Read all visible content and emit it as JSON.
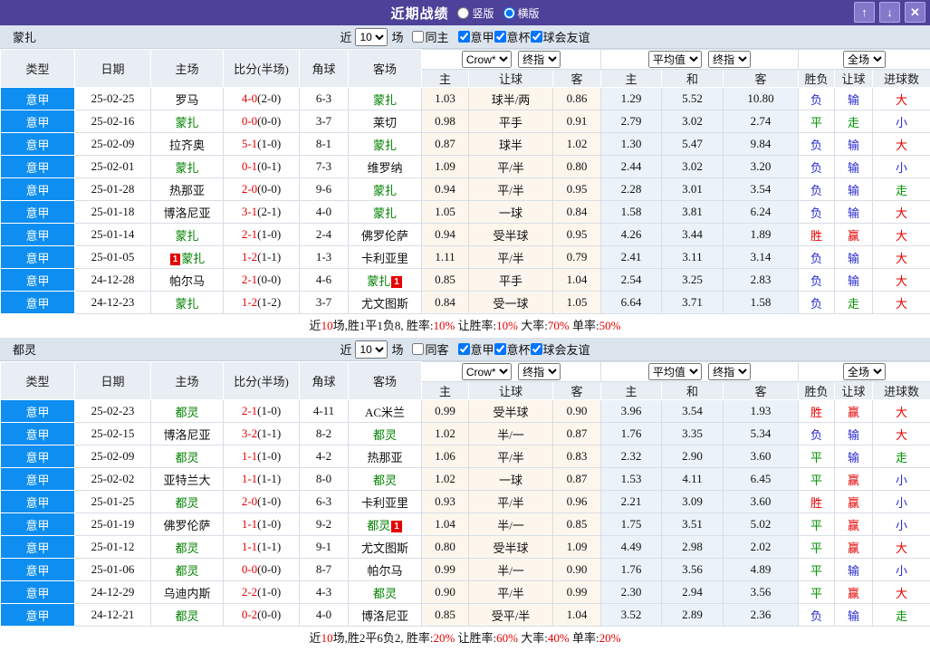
{
  "titlebar": {
    "title": "近期战绩",
    "vertical_label": "竖版",
    "horizontal_label": "横版",
    "selected_layout": "横版"
  },
  "icons": {
    "up": "↑",
    "down": "↓",
    "close": "✕"
  },
  "colors": {
    "purple": "#4d4199",
    "btn_purple": "#8478cb",
    "league_blue": "#0d8ef0",
    "red": "#e60000",
    "blue": "#2a2ad0",
    "green": "#009200",
    "team_green": "#008000",
    "section_bg": "#dce5ee",
    "header_bg": "#e9eef4",
    "crow_bg": "#fdf6ed",
    "avg_bg": "#eaf3f9",
    "grid": "#d8dee6"
  },
  "columns": {
    "left": [
      "类型",
      "日期",
      "主场",
      "比分(半场)",
      "角球",
      "客场"
    ],
    "sub": [
      "主",
      "让球",
      "客",
      "主",
      "和",
      "客",
      "胜负",
      "让球",
      "进球数"
    ]
  },
  "selects": {
    "crow": "Crow*",
    "crow_final": "终指",
    "avg": "平均值",
    "avg_final": "终指",
    "scope": "全场"
  },
  "result_color_map": {
    "胜": "red",
    "平": "green",
    "负": "blue",
    "赢": "red",
    "输": "blue",
    "走": "green",
    "大": "red",
    "小": "blue"
  },
  "sections": [
    {
      "team": "蒙扎",
      "filter": {
        "prefix": "近",
        "count": "10",
        "suffix": "场",
        "venue_label": "同主",
        "venue_checked": false,
        "leagues": [
          {
            "label": "意甲",
            "checked": true
          },
          {
            "label": "意杯",
            "checked": true
          },
          {
            "label": "球会友谊",
            "checked": true
          }
        ]
      },
      "rows": [
        {
          "league": "意甲",
          "date": "25-02-25",
          "home": "罗马",
          "home_self": false,
          "home_rc": null,
          "score": "4-0",
          "half": "(2-0)",
          "corner": "6-3",
          "away": "蒙扎",
          "away_self": true,
          "away_rc": null,
          "crow": [
            "1.03",
            "球半/两",
            "0.86"
          ],
          "avg": [
            "1.29",
            "5.52",
            "10.80"
          ],
          "res": [
            "负",
            "输",
            "大"
          ]
        },
        {
          "league": "意甲",
          "date": "25-02-16",
          "home": "蒙扎",
          "home_self": true,
          "home_rc": null,
          "score": "0-0",
          "half": "(0-0)",
          "corner": "3-7",
          "away": "莱切",
          "away_self": false,
          "away_rc": null,
          "crow": [
            "0.98",
            "平手",
            "0.91"
          ],
          "avg": [
            "2.79",
            "3.02",
            "2.74"
          ],
          "res": [
            "平",
            "走",
            "小"
          ]
        },
        {
          "league": "意甲",
          "date": "25-02-09",
          "home": "拉齐奥",
          "home_self": false,
          "home_rc": null,
          "score": "5-1",
          "half": "(1-0)",
          "corner": "8-1",
          "away": "蒙扎",
          "away_self": true,
          "away_rc": null,
          "crow": [
            "0.87",
            "球半",
            "1.02"
          ],
          "avg": [
            "1.30",
            "5.47",
            "9.84"
          ],
          "res": [
            "负",
            "输",
            "大"
          ]
        },
        {
          "league": "意甲",
          "date": "25-02-01",
          "home": "蒙扎",
          "home_self": true,
          "home_rc": null,
          "score": "0-1",
          "half": "(0-1)",
          "corner": "7-3",
          "away": "维罗纳",
          "away_self": false,
          "away_rc": null,
          "crow": [
            "1.09",
            "平/半",
            "0.80"
          ],
          "avg": [
            "2.44",
            "3.02",
            "3.20"
          ],
          "res": [
            "负",
            "输",
            "小"
          ]
        },
        {
          "league": "意甲",
          "date": "25-01-28",
          "home": "热那亚",
          "home_self": false,
          "home_rc": null,
          "score": "2-0",
          "half": "(0-0)",
          "corner": "9-6",
          "away": "蒙扎",
          "away_self": true,
          "away_rc": null,
          "crow": [
            "0.94",
            "平/半",
            "0.95"
          ],
          "avg": [
            "2.28",
            "3.01",
            "3.54"
          ],
          "res": [
            "负",
            "输",
            "走"
          ]
        },
        {
          "league": "意甲",
          "date": "25-01-18",
          "home": "博洛尼亚",
          "home_self": false,
          "home_rc": null,
          "score": "3-1",
          "half": "(2-1)",
          "corner": "4-0",
          "away": "蒙扎",
          "away_self": true,
          "away_rc": null,
          "crow": [
            "1.05",
            "一球",
            "0.84"
          ],
          "avg": [
            "1.58",
            "3.81",
            "6.24"
          ],
          "res": [
            "负",
            "输",
            "大"
          ]
        },
        {
          "league": "意甲",
          "date": "25-01-14",
          "home": "蒙扎",
          "home_self": true,
          "home_rc": null,
          "score": "2-1",
          "half": "(1-0)",
          "corner": "2-4",
          "away": "佛罗伦萨",
          "away_self": false,
          "away_rc": null,
          "crow": [
            "0.94",
            "受半球",
            "0.95"
          ],
          "avg": [
            "4.26",
            "3.44",
            "1.89"
          ],
          "res": [
            "胜",
            "赢",
            "大"
          ]
        },
        {
          "league": "意甲",
          "date": "25-01-05",
          "home": "蒙扎",
          "home_self": true,
          "home_rc": "1",
          "score": "1-2",
          "half": "(1-1)",
          "corner": "1-3",
          "away": "卡利亚里",
          "away_self": false,
          "away_rc": null,
          "crow": [
            "1.11",
            "平/半",
            "0.79"
          ],
          "avg": [
            "2.41",
            "3.11",
            "3.14"
          ],
          "res": [
            "负",
            "输",
            "大"
          ]
        },
        {
          "league": "意甲",
          "date": "24-12-28",
          "home": "帕尔马",
          "home_self": false,
          "home_rc": null,
          "score": "2-1",
          "half": "(0-0)",
          "corner": "4-6",
          "away": "蒙扎",
          "away_self": true,
          "away_rc": "1",
          "crow": [
            "0.85",
            "平手",
            "1.04"
          ],
          "avg": [
            "2.54",
            "3.25",
            "2.83"
          ],
          "res": [
            "负",
            "输",
            "大"
          ]
        },
        {
          "league": "意甲",
          "date": "24-12-23",
          "home": "蒙扎",
          "home_self": true,
          "home_rc": null,
          "score": "1-2",
          "half": "(1-2)",
          "corner": "3-7",
          "away": "尤文图斯",
          "away_self": false,
          "away_rc": null,
          "crow": [
            "0.84",
            "受一球",
            "1.05"
          ],
          "avg": [
            "6.64",
            "3.71",
            "1.58"
          ],
          "res": [
            "负",
            "走",
            "大"
          ]
        }
      ],
      "summary": [
        [
          "近",
          false
        ],
        [
          "10",
          true
        ],
        [
          "场,胜1平1负8, 胜率:",
          false
        ],
        [
          "10%",
          true
        ],
        [
          " 让胜率:",
          false
        ],
        [
          "10%",
          true
        ],
        [
          " 大率:",
          false
        ],
        [
          "70%",
          true
        ],
        [
          " 单率:",
          false
        ],
        [
          "50%",
          true
        ]
      ]
    },
    {
      "team": "都灵",
      "filter": {
        "prefix": "近",
        "count": "10",
        "suffix": "场",
        "venue_label": "同客",
        "venue_checked": false,
        "leagues": [
          {
            "label": "意甲",
            "checked": true
          },
          {
            "label": "意杯",
            "checked": true
          },
          {
            "label": "球会友谊",
            "checked": true
          }
        ]
      },
      "rows": [
        {
          "league": "意甲",
          "date": "25-02-23",
          "home": "都灵",
          "home_self": true,
          "home_rc": null,
          "score": "2-1",
          "half": "(1-0)",
          "corner": "4-11",
          "away": "AC米兰",
          "away_self": false,
          "away_rc": null,
          "crow": [
            "0.99",
            "受半球",
            "0.90"
          ],
          "avg": [
            "3.96",
            "3.54",
            "1.93"
          ],
          "res": [
            "胜",
            "赢",
            "大"
          ]
        },
        {
          "league": "意甲",
          "date": "25-02-15",
          "home": "博洛尼亚",
          "home_self": false,
          "home_rc": null,
          "score": "3-2",
          "half": "(1-1)",
          "corner": "8-2",
          "away": "都灵",
          "away_self": true,
          "away_rc": null,
          "crow": [
            "1.02",
            "半/一",
            "0.87"
          ],
          "avg": [
            "1.76",
            "3.35",
            "5.34"
          ],
          "res": [
            "负",
            "输",
            "大"
          ]
        },
        {
          "league": "意甲",
          "date": "25-02-09",
          "home": "都灵",
          "home_self": true,
          "home_rc": null,
          "score": "1-1",
          "half": "(1-0)",
          "corner": "4-2",
          "away": "热那亚",
          "away_self": false,
          "away_rc": null,
          "crow": [
            "1.06",
            "平/半",
            "0.83"
          ],
          "avg": [
            "2.32",
            "2.90",
            "3.60"
          ],
          "res": [
            "平",
            "输",
            "走"
          ]
        },
        {
          "league": "意甲",
          "date": "25-02-02",
          "home": "亚特兰大",
          "home_self": false,
          "home_rc": null,
          "score": "1-1",
          "half": "(1-1)",
          "corner": "8-0",
          "away": "都灵",
          "away_self": true,
          "away_rc": null,
          "crow": [
            "1.02",
            "一球",
            "0.87"
          ],
          "avg": [
            "1.53",
            "4.11",
            "6.45"
          ],
          "res": [
            "平",
            "赢",
            "小"
          ]
        },
        {
          "league": "意甲",
          "date": "25-01-25",
          "home": "都灵",
          "home_self": true,
          "home_rc": null,
          "score": "2-0",
          "half": "(1-0)",
          "corner": "6-3",
          "away": "卡利亚里",
          "away_self": false,
          "away_rc": null,
          "crow": [
            "0.93",
            "平/半",
            "0.96"
          ],
          "avg": [
            "2.21",
            "3.09",
            "3.60"
          ],
          "res": [
            "胜",
            "赢",
            "小"
          ]
        },
        {
          "league": "意甲",
          "date": "25-01-19",
          "home": "佛罗伦萨",
          "home_self": false,
          "home_rc": null,
          "score": "1-1",
          "half": "(1-0)",
          "corner": "9-2",
          "away": "都灵",
          "away_self": true,
          "away_rc": "1",
          "crow": [
            "1.04",
            "半/一",
            "0.85"
          ],
          "avg": [
            "1.75",
            "3.51",
            "5.02"
          ],
          "res": [
            "平",
            "赢",
            "小"
          ]
        },
        {
          "league": "意甲",
          "date": "25-01-12",
          "home": "都灵",
          "home_self": true,
          "home_rc": null,
          "score": "1-1",
          "half": "(1-1)",
          "corner": "9-1",
          "away": "尤文图斯",
          "away_self": false,
          "away_rc": null,
          "crow": [
            "0.80",
            "受半球",
            "1.09"
          ],
          "avg": [
            "4.49",
            "2.98",
            "2.02"
          ],
          "res": [
            "平",
            "赢",
            "大"
          ]
        },
        {
          "league": "意甲",
          "date": "25-01-06",
          "home": "都灵",
          "home_self": true,
          "home_rc": null,
          "score": "0-0",
          "half": "(0-0)",
          "corner": "8-7",
          "away": "帕尔马",
          "away_self": false,
          "away_rc": null,
          "crow": [
            "0.99",
            "半/一",
            "0.90"
          ],
          "avg": [
            "1.76",
            "3.56",
            "4.89"
          ],
          "res": [
            "平",
            "输",
            "小"
          ]
        },
        {
          "league": "意甲",
          "date": "24-12-29",
          "home": "乌迪内斯",
          "home_self": false,
          "home_rc": null,
          "score": "2-2",
          "half": "(1-0)",
          "corner": "4-3",
          "away": "都灵",
          "away_self": true,
          "away_rc": null,
          "crow": [
            "0.90",
            "平/半",
            "0.99"
          ],
          "avg": [
            "2.30",
            "2.94",
            "3.56"
          ],
          "res": [
            "平",
            "赢",
            "大"
          ]
        },
        {
          "league": "意甲",
          "date": "24-12-21",
          "home": "都灵",
          "home_self": true,
          "home_rc": null,
          "score": "0-2",
          "half": "(0-0)",
          "corner": "4-0",
          "away": "博洛尼亚",
          "away_self": false,
          "away_rc": null,
          "crow": [
            "0.85",
            "受平/半",
            "1.04"
          ],
          "avg": [
            "3.52",
            "2.89",
            "2.36"
          ],
          "res": [
            "负",
            "输",
            "走"
          ]
        }
      ],
      "summary": [
        [
          "近",
          false
        ],
        [
          "10",
          true
        ],
        [
          "场,胜2平6负2, 胜率:",
          false
        ],
        [
          "20%",
          true
        ],
        [
          " 让胜率:",
          false
        ],
        [
          "60%",
          true
        ],
        [
          " 大率:",
          false
        ],
        [
          "40%",
          true
        ],
        [
          " 单率:",
          false
        ],
        [
          "20%",
          true
        ]
      ]
    }
  ]
}
